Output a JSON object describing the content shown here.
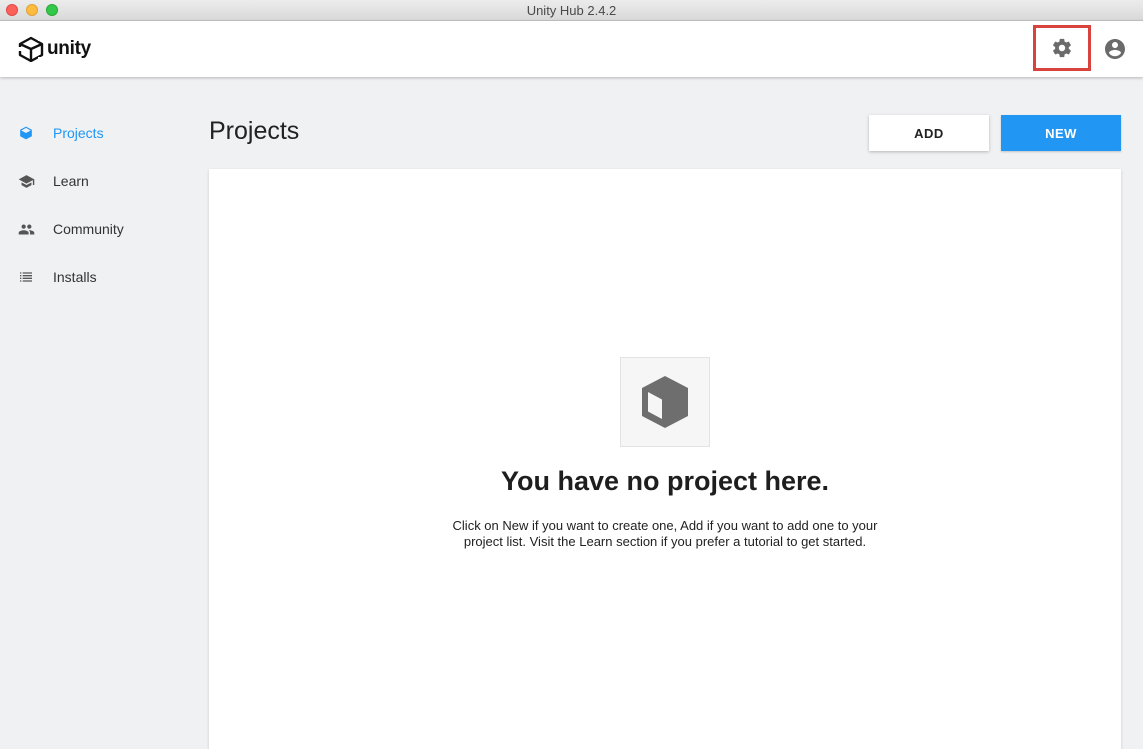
{
  "window": {
    "title": "Unity Hub 2.4.2"
  },
  "header": {
    "logo_text": "unity",
    "settings_icon": "gear-icon",
    "account_icon": "account-circle-icon",
    "highlight_color": "#d9433d"
  },
  "sidebar": {
    "items": [
      {
        "label": "Projects",
        "icon": "cube-icon",
        "active": true
      },
      {
        "label": "Learn",
        "icon": "graduation-cap-icon",
        "active": false
      },
      {
        "label": "Community",
        "icon": "people-icon",
        "active": false
      },
      {
        "label": "Installs",
        "icon": "list-icon",
        "active": false
      }
    ],
    "active_color": "#2196f3"
  },
  "main": {
    "title": "Projects",
    "add_label": "ADD",
    "new_label": "NEW",
    "empty_title": "You have no project here.",
    "empty_description": "Click on New if you want to create one, Add if you want to add one to your project list. Visit the Learn section if you prefer a tutorial to get started."
  }
}
